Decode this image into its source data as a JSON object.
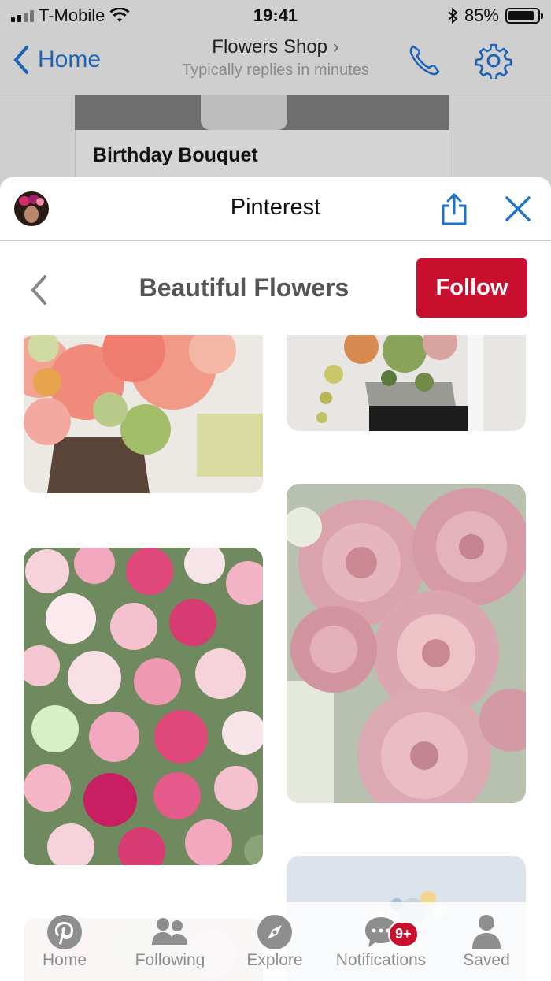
{
  "status_bar": {
    "carrier": "T-Mobile",
    "time": "19:41",
    "battery": "85%",
    "battery_level": 0.85
  },
  "chat_header": {
    "back_label": "Home",
    "title": "Flowers Shop",
    "subtitle": "Typically replies in minutes"
  },
  "message_card": {
    "title": "Birthday Bouquet"
  },
  "webview": {
    "title": "Pinterest"
  },
  "board": {
    "title": "Beautiful Flowers",
    "follow_label": "Follow"
  },
  "pins": [
    {
      "subject": "peonies-in-urn",
      "colors": {
        "primary": "#f08b7c",
        "secondary": "#b9c98a",
        "bg": "#ece9e4"
      }
    },
    {
      "subject": "hanging-bouquet",
      "colors": {
        "primary": "#d78b50",
        "secondary": "#8aa35a",
        "bg": "#e8e6e3"
      }
    },
    {
      "subject": "ranunculus-pink-white",
      "colors": {
        "primary": "#e0487c",
        "secondary": "#f6d3db",
        "bg": "#6f8a5e"
      }
    },
    {
      "subject": "pink-ranunculus-bouquet",
      "colors": {
        "primary": "#d9a2ac",
        "secondary": "#eec3c8",
        "bg": "#b8c1b0"
      }
    },
    {
      "subject": "pale-blue-arrangement",
      "colors": {
        "primary": "#c7d1dd",
        "secondary": "#f4d58e",
        "bg": "#dde3ea"
      }
    }
  ],
  "tab_bar": {
    "tabs": [
      {
        "label": "Home",
        "icon": "pinterest-logo-icon"
      },
      {
        "label": "Following",
        "icon": "people-icon"
      },
      {
        "label": "Explore",
        "icon": "compass-icon"
      },
      {
        "label": "Notifications",
        "icon": "speech-bubble-icon",
        "badge": "9+"
      },
      {
        "label": "Saved",
        "icon": "person-icon"
      }
    ]
  },
  "colors": {
    "accent_red": "#c8102e",
    "ios_blue": "#1d63b8",
    "link_blue": "#1a73c8"
  }
}
